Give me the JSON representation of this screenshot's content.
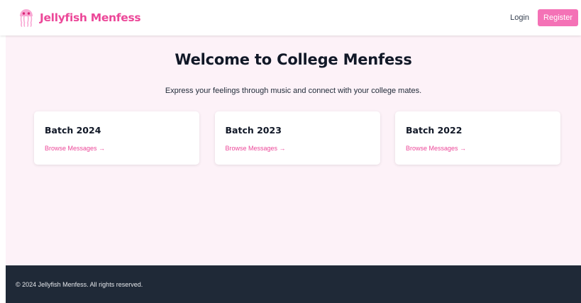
{
  "brand": {
    "name": "Jellyfish Menfess",
    "logo_icon": "jellyfish-icon"
  },
  "nav": {
    "login_label": "Login",
    "register_label": "Register"
  },
  "hero": {
    "title": "Welcome to College Menfess",
    "subtitle": "Express your feelings through music and connect with your college mates."
  },
  "batches": [
    {
      "title": "Batch 2024",
      "link_label": "Browse Messages →"
    },
    {
      "title": "Batch 2023",
      "link_label": "Browse Messages →"
    },
    {
      "title": "Batch 2022",
      "link_label": "Browse Messages →"
    }
  ],
  "footer": {
    "text": "© 2024 Jellyfish Menfess. All rights reserved."
  },
  "colors": {
    "brand_pink": "#ec4899",
    "button_pink": "#f472b6",
    "page_bg": "#fdf2f8",
    "footer_bg": "#1f2937"
  }
}
